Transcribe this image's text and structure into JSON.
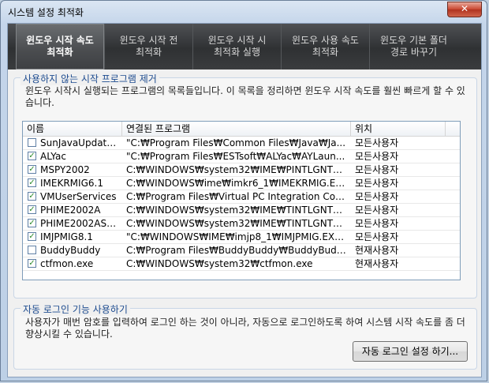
{
  "window": {
    "title": "시스템 설정 최적화",
    "close_label": "✕"
  },
  "tabs": [
    {
      "label": "윈도우 시작 속도\n최적화",
      "active": true
    },
    {
      "label": "윈도우 시작 전\n최적화",
      "active": false
    },
    {
      "label": "윈도우 시작 시\n최적화 실행",
      "active": false
    },
    {
      "label": "윈도우 사용 속도\n최적화",
      "active": false
    },
    {
      "label": "윈도우 기본 폴더\n경로 바꾸기",
      "active": false
    }
  ],
  "startup_group": {
    "title": "사용하지 않는 시작 프로그램 제거",
    "description": "윈도우 시작시 실행되는 프로그램의 목록들입니다. 이 목록을 정리하면 윈도우 시작 속도를 훨씬 빠르게 할 수 있습니다.",
    "columns": [
      "이름",
      "연결된 프로그램",
      "위치"
    ],
    "rows": [
      {
        "checked": false,
        "name": "SunJavaUpdate...",
        "program": "\"C:₩Program Files₩Common Files₩Java₩Ja...",
        "location": "모든사용자"
      },
      {
        "checked": true,
        "name": "ALYac",
        "program": "\"C:₩Program Files₩ESTsoft₩ALYac₩AYLaun...",
        "location": "모든사용자"
      },
      {
        "checked": true,
        "name": "MSPY2002",
        "program": "C:₩WINDOWS₩system32₩IME₩PINTLGNT₩...",
        "location": "모든사용자"
      },
      {
        "checked": true,
        "name": "IMEKRMIG6.1",
        "program": "C:₩WINDOWS₩ime₩imkr6_1₩IMEKRMIG.EXE",
        "location": "모든사용자"
      },
      {
        "checked": true,
        "name": "VMUserServices",
        "program": "C:₩Program Files₩Virtual PC Integration Com...",
        "location": "모든사용자"
      },
      {
        "checked": true,
        "name": "PHIME2002A",
        "program": "C:₩WINDOWS₩system32₩IME₩TINTLGNT₩...",
        "location": "모든사용자"
      },
      {
        "checked": true,
        "name": "PHIME2002ASync",
        "program": "C:₩WINDOWS₩system32₩IME₩TINTLGNT₩...",
        "location": "모든사용자"
      },
      {
        "checked": true,
        "name": "IMJPMIG8.1",
        "program": "\"C:₩WINDOWS₩IME₩imjp8_1₩IMJPMIG.EXE\"...",
        "location": "모든사용자"
      },
      {
        "checked": false,
        "name": "BuddyBuddy",
        "program": "C:₩Program Files₩BuddyBuddy₩BuddyBudd...",
        "location": "현재사용자"
      },
      {
        "checked": true,
        "name": "ctfmon.exe",
        "program": "C:₩WINDOWS₩system32₩ctfmon.exe",
        "location": "현재사용자"
      }
    ]
  },
  "autologin_group": {
    "title": "자동 로그인 기능 사용하기",
    "description": "사용자가 매번 암호를 입력하여 로그인 하는 것이 아니라, 자동으로 로그인하도록 하여 시스템 시작 속도를 좀 더 향상시킬 수 있습니다.",
    "button_label": "자동 로그인 설정 하기..."
  }
}
